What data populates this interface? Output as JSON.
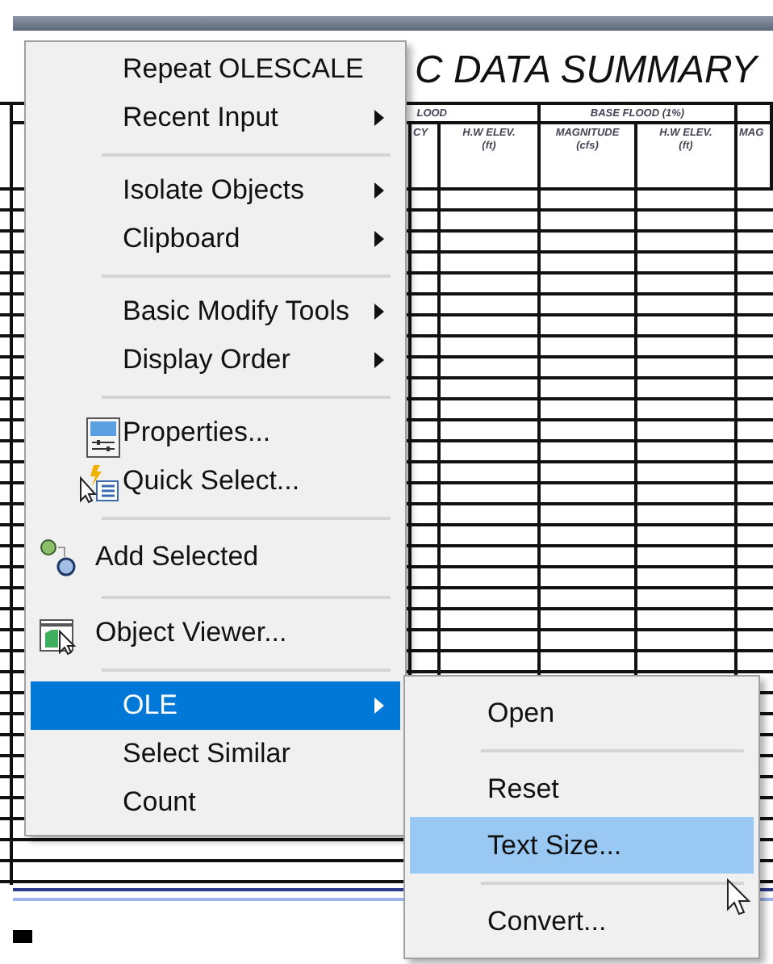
{
  "drawing": {
    "title": "C DATA SUMMARY",
    "group_headers": [
      "LOOD",
      "BASE FLOOD (1%)"
    ],
    "column_headers": [
      "CY",
      "H.W ELEV. (ft)",
      "MAGNITUDE (cfs)",
      "H.W ELEV. (ft)",
      "MAG"
    ]
  },
  "context_menu": {
    "items": [
      {
        "kind": "text",
        "label": "Repeat OLESCALE",
        "selected": false
      },
      {
        "kind": "submenu",
        "label": "Recent Input",
        "selected": false
      },
      {
        "kind": "separator"
      },
      {
        "kind": "submenu",
        "label": "Isolate Objects",
        "selected": false
      },
      {
        "kind": "submenu",
        "label": "Clipboard",
        "selected": false
      },
      {
        "kind": "separator"
      },
      {
        "kind": "submenu",
        "label": "Basic Modify Tools",
        "selected": false
      },
      {
        "kind": "submenu",
        "label": "Display Order",
        "selected": false
      },
      {
        "kind": "separator"
      },
      {
        "kind": "properties",
        "label": "Properties...",
        "selected": false
      },
      {
        "kind": "quick-select",
        "label": "Quick Select...",
        "selected": false
      },
      {
        "kind": "separator"
      },
      {
        "kind": "add-selected",
        "label": "Add Selected",
        "selected": false
      },
      {
        "kind": "separator"
      },
      {
        "kind": "object-viewer",
        "label": "Object Viewer...",
        "selected": false
      },
      {
        "kind": "separator"
      },
      {
        "kind": "submenu",
        "label": "OLE",
        "selected": true
      },
      {
        "kind": "text",
        "label": "Select Similar",
        "selected": false
      },
      {
        "kind": "text",
        "label": "Count",
        "selected": false
      }
    ]
  },
  "submenu": {
    "items": [
      {
        "kind": "text",
        "label": "Open",
        "selected": false
      },
      {
        "kind": "separator"
      },
      {
        "kind": "text",
        "label": "Reset",
        "selected": false
      },
      {
        "kind": "text",
        "label": "Text Size...",
        "selected": true
      },
      {
        "kind": "separator"
      },
      {
        "kind": "text",
        "label": "Convert...",
        "selected": false
      }
    ]
  }
}
